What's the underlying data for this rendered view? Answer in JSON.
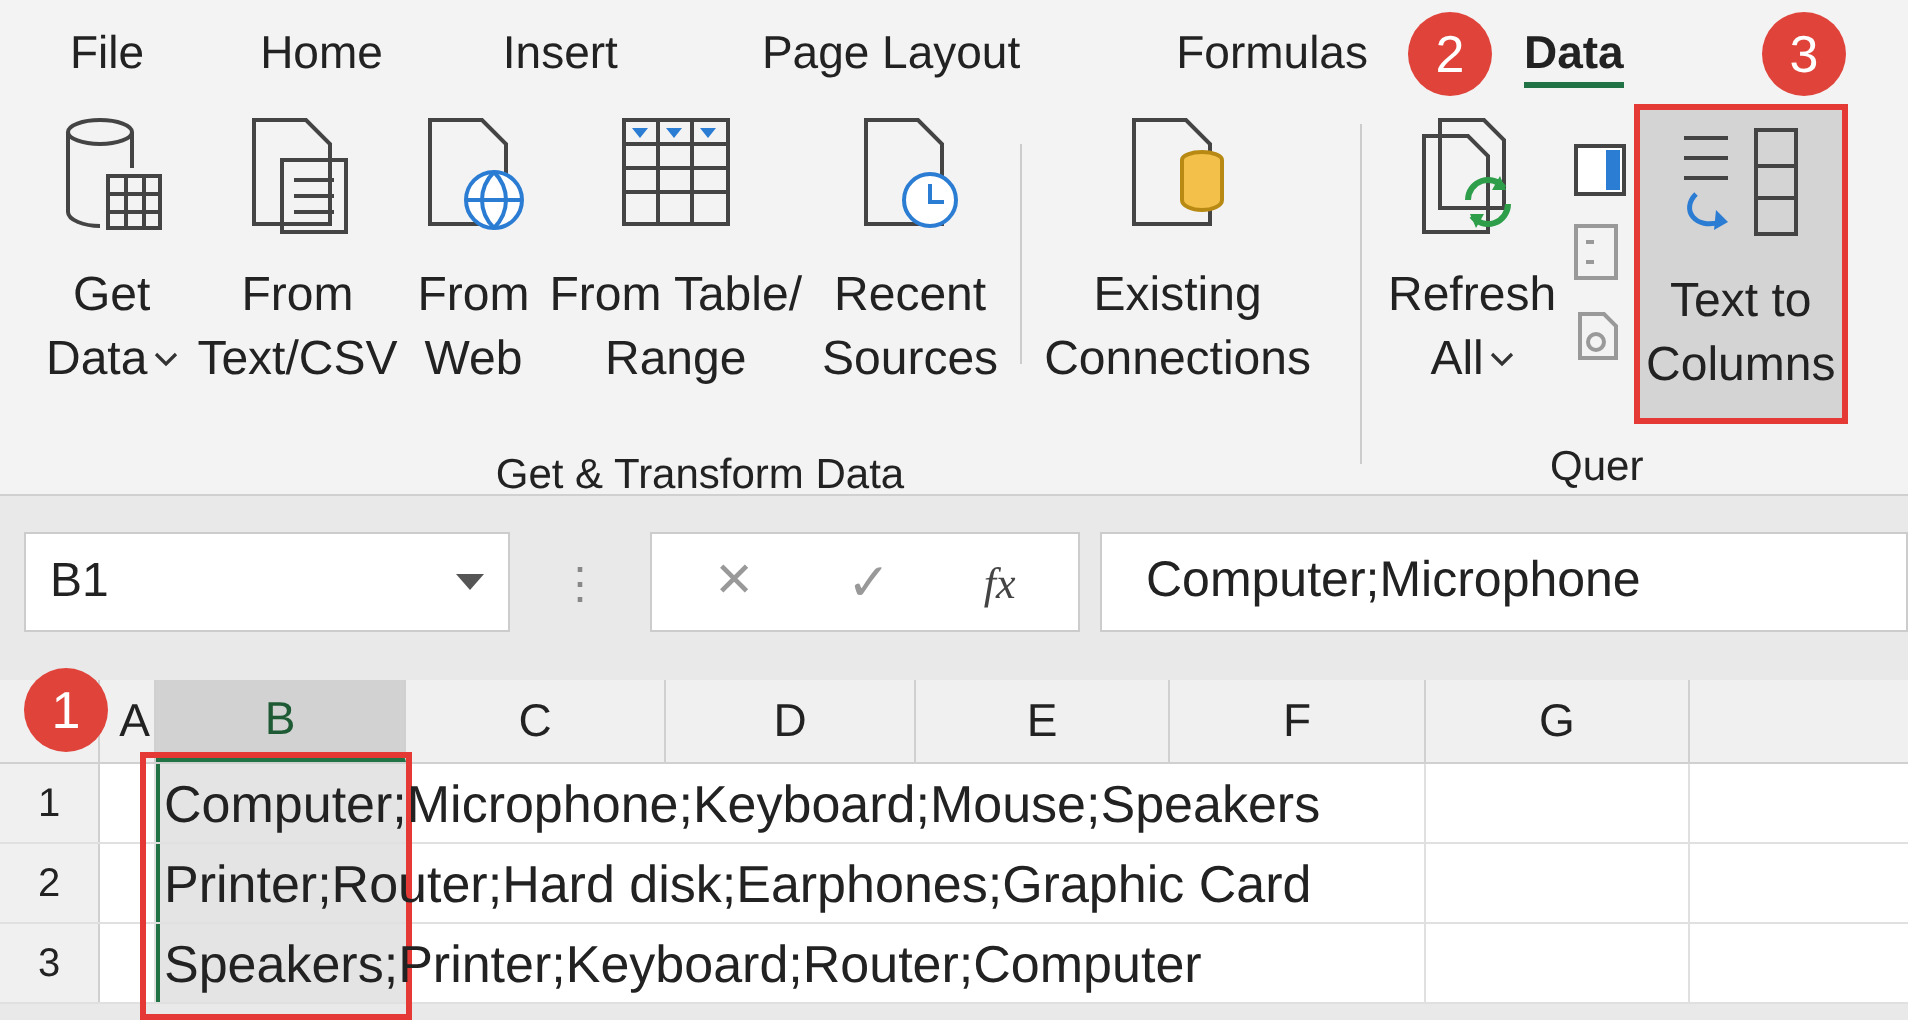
{
  "tabs": [
    {
      "label": "File",
      "selected": false
    },
    {
      "label": "Home",
      "selected": false
    },
    {
      "label": "Insert",
      "selected": false
    },
    {
      "label": "Page Layout",
      "selected": false
    },
    {
      "label": "Formulas",
      "selected": false
    },
    {
      "label": "Data",
      "selected": true
    }
  ],
  "ribbon": {
    "groups": [
      {
        "label": "Get & Transform Data",
        "buttons": [
          {
            "kind": "database",
            "lines": [
              "Get",
              "Data"
            ],
            "dropdown": true
          },
          {
            "kind": "textfile",
            "lines": [
              "From",
              "Text/CSV"
            ],
            "dropdown": false
          },
          {
            "kind": "web",
            "lines": [
              "From",
              "Web"
            ],
            "dropdown": false
          },
          {
            "kind": "table",
            "lines": [
              "From Table/",
              "Range"
            ],
            "dropdown": false
          },
          {
            "kind": "recent",
            "lines": [
              "Recent",
              "Sources"
            ],
            "dropdown": false
          },
          {
            "kind": "connections",
            "lines": [
              "Existing",
              "Connections"
            ],
            "dropdown": false
          }
        ]
      },
      {
        "label": "Quer",
        "buttons": [
          {
            "kind": "refresh",
            "lines": [
              "Refresh",
              "All"
            ],
            "dropdown": true
          },
          {
            "kind": "columns",
            "lines": [
              "Text to",
              "Columns"
            ],
            "dropdown": false,
            "highlighted": true
          }
        ]
      }
    ]
  },
  "formula_bar": {
    "name_box": "B1",
    "more": "⋮",
    "cancel": "✕",
    "enter": "✓",
    "function": "fx",
    "formula": "Computer;Microphone"
  },
  "grid": {
    "columns": [
      {
        "label": "A",
        "selected": false
      },
      {
        "label": "B",
        "selected": true
      },
      {
        "label": "C",
        "selected": false
      },
      {
        "label": "D",
        "selected": false
      },
      {
        "label": "E",
        "selected": false
      },
      {
        "label": "F",
        "selected": false
      },
      {
        "label": "G",
        "selected": false
      }
    ],
    "rows": [
      {
        "number": "1",
        "text": "Computer;Microphone;Keyboard;Mouse;Speakers"
      },
      {
        "number": "2",
        "text": "Printer;Router;Hard disk;Earphones;Graphic Card"
      },
      {
        "number": "3",
        "text": "Speakers;Printer;Keyboard;Router;Computer"
      }
    ]
  },
  "badges": [
    {
      "label": "1"
    },
    {
      "label": "2"
    },
    {
      "label": "3"
    }
  ]
}
